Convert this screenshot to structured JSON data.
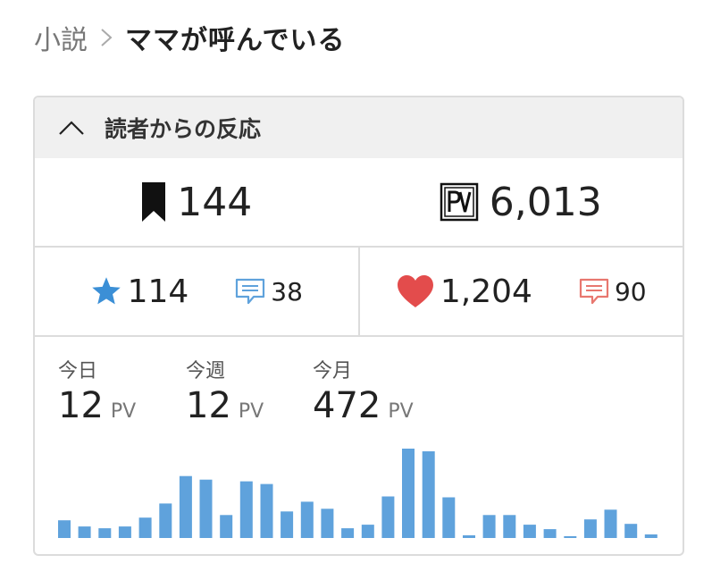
{
  "breadcrumb": {
    "parent": "小説",
    "title": "ママが呼んでいる"
  },
  "panel": {
    "title": "読者からの反応",
    "bookmarks": "144",
    "pv": "6,013",
    "stars": "114",
    "star_comments": "38",
    "hearts": "1,204",
    "heart_comments": "90"
  },
  "stats": {
    "today_label": "今日",
    "today_value": "12",
    "week_label": "今週",
    "week_value": "12",
    "month_label": "今月",
    "month_value": "472",
    "unit": "PV"
  },
  "colors": {
    "bar": "#5fa2dc",
    "star": "#3b8fd6",
    "heart": "#e34c4c",
    "heart_comment": "#e8776f",
    "border": "#dcdcdc",
    "header_bg": "#f0f0f0"
  },
  "chart_data": {
    "type": "bar",
    "values": [
      20,
      13,
      11,
      13,
      23,
      39,
      70,
      66,
      26,
      64,
      61,
      30,
      41,
      33,
      11,
      15,
      47,
      101,
      98,
      46,
      3,
      26,
      26,
      15,
      10,
      2,
      21,
      32,
      16,
      4
    ]
  }
}
